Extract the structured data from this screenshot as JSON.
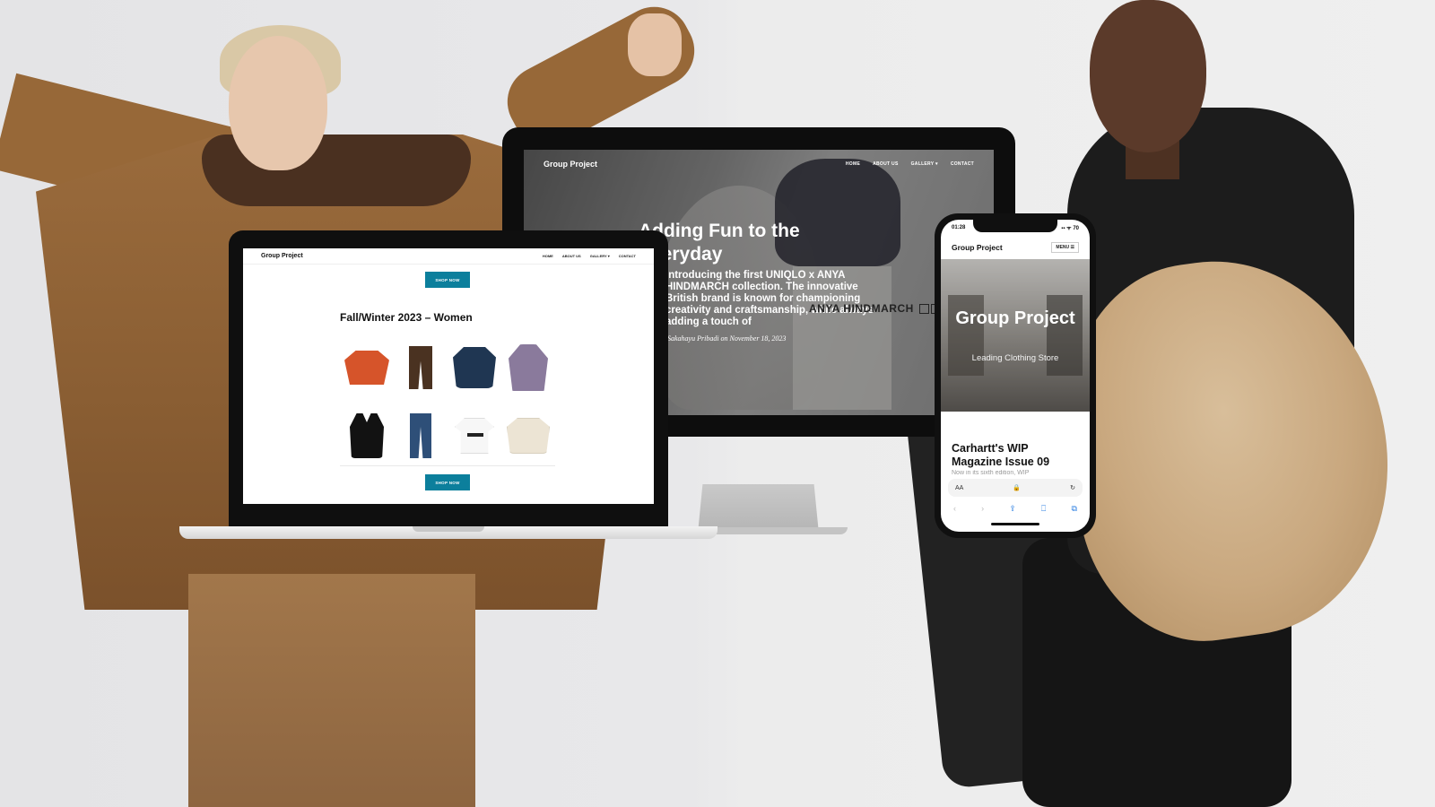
{
  "monitor": {
    "brand": "Group Project",
    "nav": [
      "HOME",
      "ABOUT US",
      "GALLERY ▾",
      "CONTACT"
    ],
    "headline": "Adding Fun to the Everyday",
    "intro": "Introducing the first UNIQLO x ANYA HINDMARCH collection. The innovative British brand is known for championing creativity and craftsmanship, while always adding a touch of",
    "brand_mark": "ANYA HINDMARCH",
    "byline": "Sakahayu Pribadi on November 18, 2023"
  },
  "laptop": {
    "brand": "Group Project",
    "nav": [
      "HOME",
      "ABOUT US",
      "GALLERY ▾",
      "CONTACT"
    ],
    "shop_button_top": "SHOP NOW",
    "collection_title": "Fall/Winter 2023 – Women",
    "products": [
      "sweater",
      "pants",
      "jacket",
      "hoodie",
      "vest",
      "jeans",
      "t-shirt",
      "jacket"
    ],
    "shop_button_bottom": "SHOP NOW"
  },
  "phone": {
    "time": "01:28",
    "status_icons": "▪▪ ᯤ 70",
    "brand": "Group Project",
    "menu": "MENU ☰",
    "hero_title": "Group Project",
    "hero_subtitle": "Leading Clothing Store",
    "article_title": "Carhartt's WIP Magazine Issue 09",
    "article_excerpt": "Now in its sixth edition, WIP",
    "url_text_size": "AA",
    "url_lock": "🔒",
    "reload": "↻",
    "toolbar": [
      "‹",
      "›",
      "⇪",
      "⎕",
      "⧉"
    ]
  }
}
